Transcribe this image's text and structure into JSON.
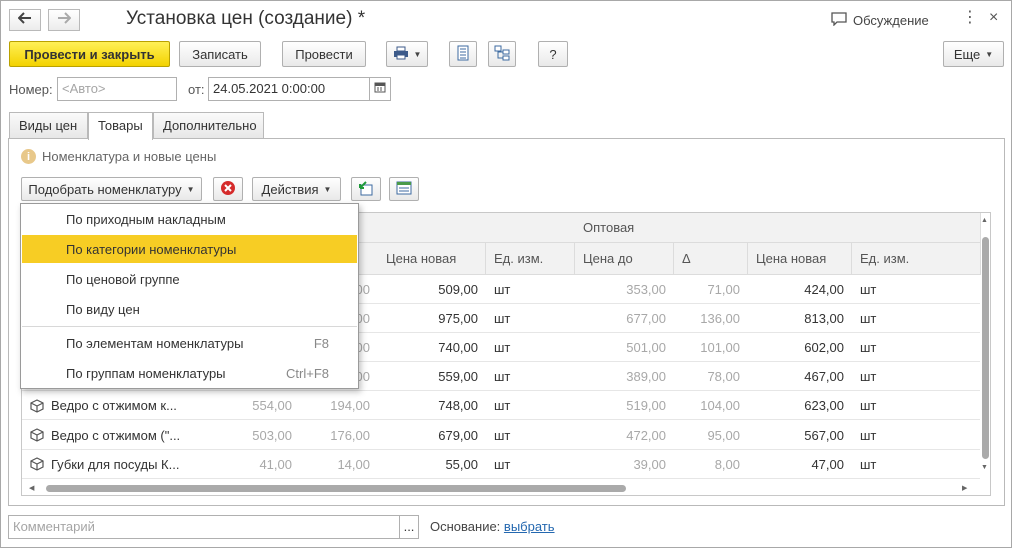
{
  "window": {
    "title": "Установка цен (создание) *",
    "discussion_label": "Обсуждение",
    "more_glyph": "⋮",
    "close_glyph": "×",
    "back_glyph": "🡐",
    "forward_glyph": "🡒"
  },
  "toolbar": {
    "post_and_close": "Провести и закрыть",
    "save": "Записать",
    "post": "Провести",
    "help": "?",
    "more": "Еще"
  },
  "header": {
    "number_label": "Номер:",
    "number_placeholder": "<Авто>",
    "date_label": "от:",
    "date_value": "24.05.2021  0:00:00"
  },
  "tabs": [
    "Виды цен",
    "Товары",
    "Дополнительно"
  ],
  "active_tab": "Товары",
  "products": {
    "info_text": "Номенклатура и новые цены",
    "pick_button": "Подобрать номенклатуру",
    "actions_button": "Действия"
  },
  "grid": {
    "group_header": "Оптовая",
    "left_columns": [
      "Цена новая",
      "Ед. изм."
    ],
    "right_columns": [
      "Цена до",
      "Δ",
      "Цена новая",
      "Ед. изм."
    ],
    "rows": [
      {
        "name": "",
        "c1": "",
        "c2": "00",
        "new1": "509,00",
        "unit1": "шт",
        "before2": "353,00",
        "delta2": "71,00",
        "new2": "424,00",
        "unit2": "шт"
      },
      {
        "name": "",
        "c1": "",
        "c2": "00",
        "new1": "975,00",
        "unit1": "шт",
        "before2": "677,00",
        "delta2": "136,00",
        "new2": "813,00",
        "unit2": "шт"
      },
      {
        "name": "",
        "c1": "",
        "c2": "00",
        "new1": "740,00",
        "unit1": "шт",
        "before2": "501,00",
        "delta2": "101,00",
        "new2": "602,00",
        "unit2": "шт"
      },
      {
        "name": "",
        "c1": "",
        "c2": "00",
        "new1": "559,00",
        "unit1": "шт",
        "before2": "389,00",
        "delta2": "78,00",
        "new2": "467,00",
        "unit2": "шт"
      },
      {
        "name": "Ведро с отжимом  к...",
        "c1": "554,00",
        "c2": "194,00",
        "new1": "748,00",
        "unit1": "шт",
        "before2": "519,00",
        "delta2": "104,00",
        "new2": "623,00",
        "unit2": "шт"
      },
      {
        "name": "Ведро с отжимом (\"...",
        "c1": "503,00",
        "c2": "176,00",
        "new1": "679,00",
        "unit1": "шт",
        "before2": "472,00",
        "delta2": "95,00",
        "new2": "567,00",
        "unit2": "шт"
      },
      {
        "name": "Губки для посуды К...",
        "c1": "41,00",
        "c2": "14,00",
        "new1": "55,00",
        "unit1": "шт",
        "before2": "39,00",
        "delta2": "8,00",
        "new2": "47,00",
        "unit2": "шт"
      }
    ]
  },
  "pick_menu": {
    "items": [
      {
        "label": "По приходным накладным",
        "shortcut": ""
      },
      {
        "label": "По категории номенклатуры",
        "shortcut": ""
      },
      {
        "label": "По ценовой группе",
        "shortcut": ""
      },
      {
        "label": "По виду цен",
        "shortcut": ""
      },
      {
        "label": "По элементам номенклатуры",
        "shortcut": "F8"
      },
      {
        "label": "По группам номенклатуры",
        "shortcut": "Ctrl+F8"
      }
    ],
    "highlighted": "По категории номенклатуры"
  },
  "footer": {
    "comment_placeholder": "Комментарий",
    "comment_button": "...",
    "basis_label": "Основание:",
    "basis_link": "выбрать"
  },
  "colors": {
    "accent_yellow": "#f7cd24",
    "link_blue": "#2468b0"
  }
}
